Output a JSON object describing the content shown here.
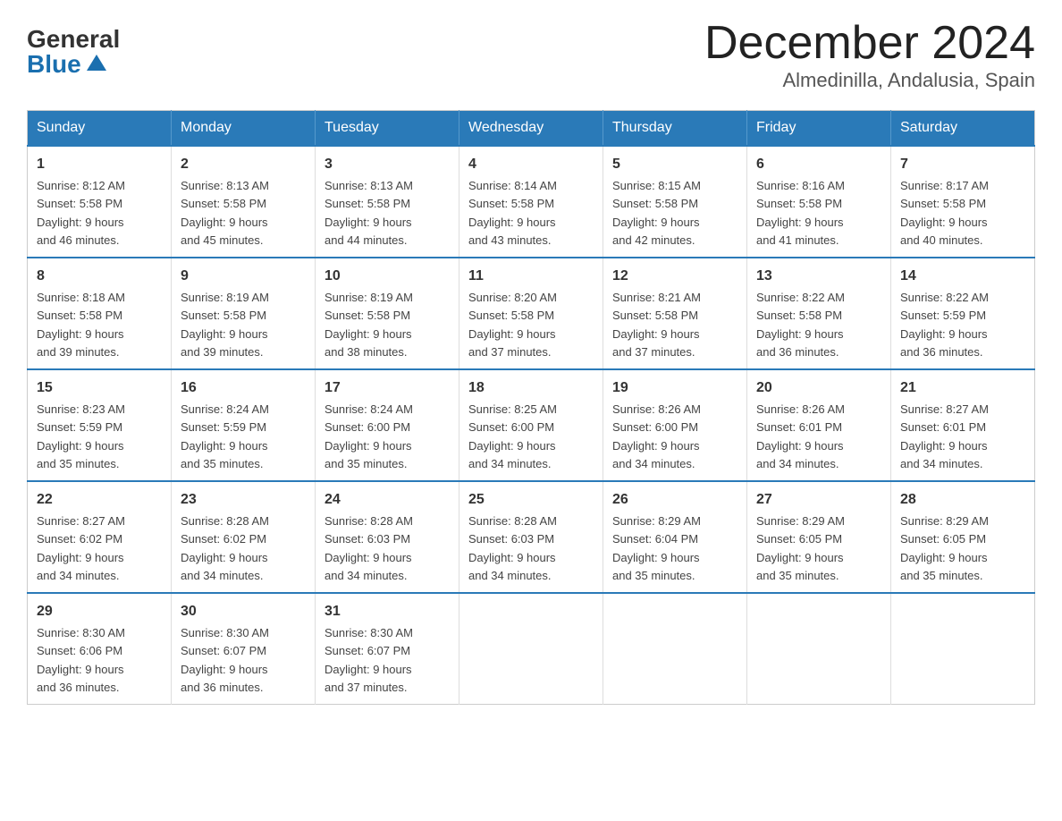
{
  "logo": {
    "general": "General",
    "blue": "Blue"
  },
  "title": {
    "month_year": "December 2024",
    "location": "Almedinilla, Andalusia, Spain"
  },
  "days_of_week": [
    "Sunday",
    "Monday",
    "Tuesday",
    "Wednesday",
    "Thursday",
    "Friday",
    "Saturday"
  ],
  "weeks": [
    [
      {
        "day": "1",
        "sunrise": "8:12 AM",
        "sunset": "5:58 PM",
        "daylight": "9 hours and 46 minutes."
      },
      {
        "day": "2",
        "sunrise": "8:13 AM",
        "sunset": "5:58 PM",
        "daylight": "9 hours and 45 minutes."
      },
      {
        "day": "3",
        "sunrise": "8:13 AM",
        "sunset": "5:58 PM",
        "daylight": "9 hours and 44 minutes."
      },
      {
        "day": "4",
        "sunrise": "8:14 AM",
        "sunset": "5:58 PM",
        "daylight": "9 hours and 43 minutes."
      },
      {
        "day": "5",
        "sunrise": "8:15 AM",
        "sunset": "5:58 PM",
        "daylight": "9 hours and 42 minutes."
      },
      {
        "day": "6",
        "sunrise": "8:16 AM",
        "sunset": "5:58 PM",
        "daylight": "9 hours and 41 minutes."
      },
      {
        "day": "7",
        "sunrise": "8:17 AM",
        "sunset": "5:58 PM",
        "daylight": "9 hours and 40 minutes."
      }
    ],
    [
      {
        "day": "8",
        "sunrise": "8:18 AM",
        "sunset": "5:58 PM",
        "daylight": "9 hours and 39 minutes."
      },
      {
        "day": "9",
        "sunrise": "8:19 AM",
        "sunset": "5:58 PM",
        "daylight": "9 hours and 39 minutes."
      },
      {
        "day": "10",
        "sunrise": "8:19 AM",
        "sunset": "5:58 PM",
        "daylight": "9 hours and 38 minutes."
      },
      {
        "day": "11",
        "sunrise": "8:20 AM",
        "sunset": "5:58 PM",
        "daylight": "9 hours and 37 minutes."
      },
      {
        "day": "12",
        "sunrise": "8:21 AM",
        "sunset": "5:58 PM",
        "daylight": "9 hours and 37 minutes."
      },
      {
        "day": "13",
        "sunrise": "8:22 AM",
        "sunset": "5:58 PM",
        "daylight": "9 hours and 36 minutes."
      },
      {
        "day": "14",
        "sunrise": "8:22 AM",
        "sunset": "5:59 PM",
        "daylight": "9 hours and 36 minutes."
      }
    ],
    [
      {
        "day": "15",
        "sunrise": "8:23 AM",
        "sunset": "5:59 PM",
        "daylight": "9 hours and 35 minutes."
      },
      {
        "day": "16",
        "sunrise": "8:24 AM",
        "sunset": "5:59 PM",
        "daylight": "9 hours and 35 minutes."
      },
      {
        "day": "17",
        "sunrise": "8:24 AM",
        "sunset": "6:00 PM",
        "daylight": "9 hours and 35 minutes."
      },
      {
        "day": "18",
        "sunrise": "8:25 AM",
        "sunset": "6:00 PM",
        "daylight": "9 hours and 34 minutes."
      },
      {
        "day": "19",
        "sunrise": "8:26 AM",
        "sunset": "6:00 PM",
        "daylight": "9 hours and 34 minutes."
      },
      {
        "day": "20",
        "sunrise": "8:26 AM",
        "sunset": "6:01 PM",
        "daylight": "9 hours and 34 minutes."
      },
      {
        "day": "21",
        "sunrise": "8:27 AM",
        "sunset": "6:01 PM",
        "daylight": "9 hours and 34 minutes."
      }
    ],
    [
      {
        "day": "22",
        "sunrise": "8:27 AM",
        "sunset": "6:02 PM",
        "daylight": "9 hours and 34 minutes."
      },
      {
        "day": "23",
        "sunrise": "8:28 AM",
        "sunset": "6:02 PM",
        "daylight": "9 hours and 34 minutes."
      },
      {
        "day": "24",
        "sunrise": "8:28 AM",
        "sunset": "6:03 PM",
        "daylight": "9 hours and 34 minutes."
      },
      {
        "day": "25",
        "sunrise": "8:28 AM",
        "sunset": "6:03 PM",
        "daylight": "9 hours and 34 minutes."
      },
      {
        "day": "26",
        "sunrise": "8:29 AM",
        "sunset": "6:04 PM",
        "daylight": "9 hours and 35 minutes."
      },
      {
        "day": "27",
        "sunrise": "8:29 AM",
        "sunset": "6:05 PM",
        "daylight": "9 hours and 35 minutes."
      },
      {
        "day": "28",
        "sunrise": "8:29 AM",
        "sunset": "6:05 PM",
        "daylight": "9 hours and 35 minutes."
      }
    ],
    [
      {
        "day": "29",
        "sunrise": "8:30 AM",
        "sunset": "6:06 PM",
        "daylight": "9 hours and 36 minutes."
      },
      {
        "day": "30",
        "sunrise": "8:30 AM",
        "sunset": "6:07 PM",
        "daylight": "9 hours and 36 minutes."
      },
      {
        "day": "31",
        "sunrise": "8:30 AM",
        "sunset": "6:07 PM",
        "daylight": "9 hours and 37 minutes."
      },
      null,
      null,
      null,
      null
    ]
  ],
  "labels": {
    "sunrise": "Sunrise:",
    "sunset": "Sunset:",
    "daylight": "Daylight:"
  }
}
